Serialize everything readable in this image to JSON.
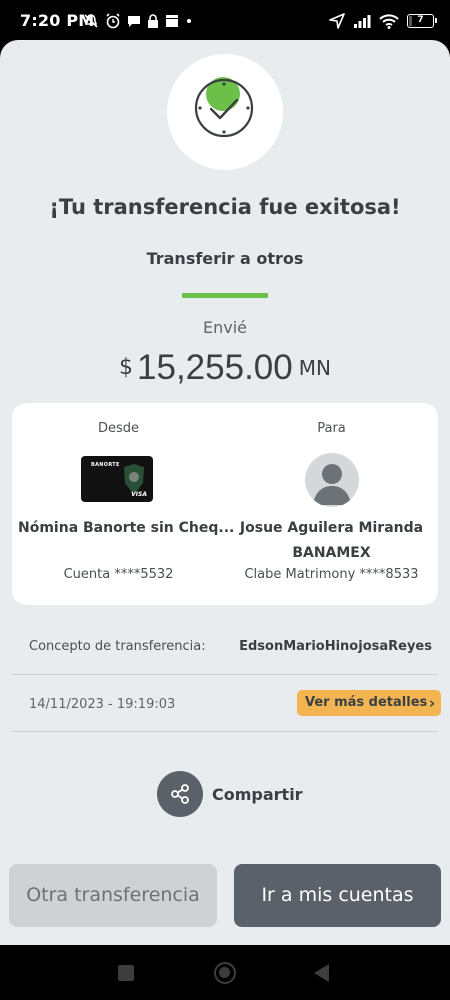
{
  "status_bar": {
    "time": "7:20 PM",
    "battery": "7"
  },
  "header": {
    "title": "¡Tu transferencia fue exitosa!",
    "transfer_type": "Transferir a otros"
  },
  "amount": {
    "label": "Envié",
    "currency_symbol": "$",
    "value": "15,255.00",
    "currency_code": "MN"
  },
  "from": {
    "heading": "Desde",
    "card_brand": "BANORTE",
    "card_network": "VISA",
    "account_name": "Nómina Banorte sin Cheq...",
    "account_number": "Cuenta ****5532"
  },
  "to": {
    "heading": "Para",
    "name": "Josue Aguilera Miranda",
    "bank": "BANAMEX",
    "account_number": "Clabe Matrimony ****8533"
  },
  "concept": {
    "label": "Concepto de transferencia:",
    "value": "EdsonMarioHinojosaReyes"
  },
  "datetime": "14/11/2023 - 19:19:03",
  "details_button": "Ver más detalles",
  "share_button": "Compartir",
  "buttons": {
    "other_transfer": "Otra transferencia",
    "my_accounts": "Ir a mis cuentas"
  },
  "colors": {
    "accent_green": "#6cc04a",
    "details_yellow": "#f3b552",
    "primary_dark": "#5a6168",
    "background": "#e9ecee"
  },
  "icons": {
    "success": "clock-check-icon",
    "share": "share-icon",
    "avatar": "user-avatar-icon"
  }
}
